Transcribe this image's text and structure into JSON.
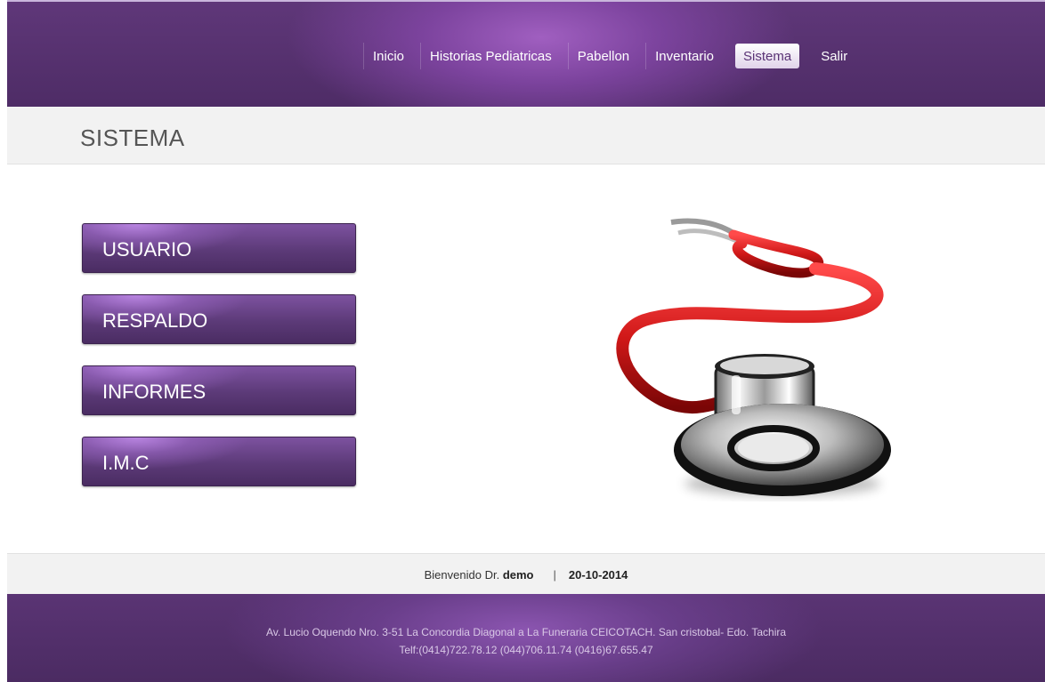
{
  "nav": {
    "items": [
      {
        "label": "Inicio"
      },
      {
        "label": "Historias Pediatricas"
      },
      {
        "label": "Pabellon"
      },
      {
        "label": "Inventario"
      },
      {
        "label": "Sistema",
        "active": true
      },
      {
        "label": "Salir"
      }
    ]
  },
  "page": {
    "title": "SISTEMA"
  },
  "menu": {
    "usuario": "USUARIO",
    "respaldo": "RESPALDO",
    "informes": "INFORMES",
    "imc": "I.M.C"
  },
  "status": {
    "welcome_prefix": "Bienvenido Dr.",
    "user": "demo",
    "separator": "|",
    "date": "20-10-2014"
  },
  "footer": {
    "address": "Av. Lucio Oquendo Nro. 3-51 La Concordia Diagonal a La Funeraria CEICOTACH. San cristobal- Edo. Tachira",
    "phones": "Telf:(0414)722.78.12 (044)706.11.74 (0416)67.655.47"
  },
  "colors": {
    "brand_purple": "#5f3779",
    "accent_purple": "#a05fc0",
    "band_grey": "#f2f2f2"
  },
  "illustration": {
    "icon": "stethoscope-icon"
  }
}
